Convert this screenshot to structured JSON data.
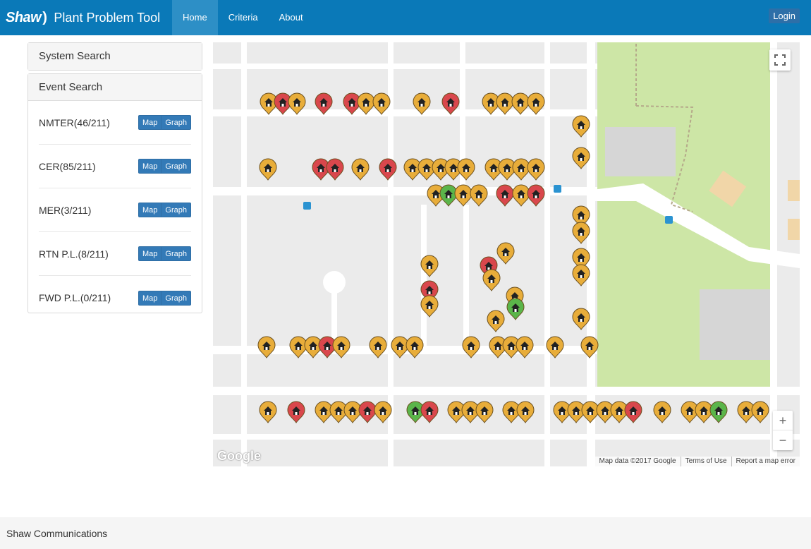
{
  "header": {
    "brand_logo": "Shaw",
    "brand_arc": ")",
    "app_title": "Plant Problem Tool",
    "nav": [
      {
        "label": "Home",
        "active": true
      },
      {
        "label": "Criteria",
        "active": false
      },
      {
        "label": "About",
        "active": false
      }
    ],
    "login_label": "Login"
  },
  "sidebar": {
    "system_search": "System Search",
    "event_search": "Event Search",
    "events": [
      {
        "label": "NMTER(46/211)",
        "map_label": "Map",
        "graph_label": "Graph"
      },
      {
        "label": "CER(85/211)",
        "map_label": "Map",
        "graph_label": "Graph"
      },
      {
        "label": "MER(3/211)",
        "map_label": "Map",
        "graph_label": "Graph"
      },
      {
        "label": "RTN P.L.(8/211)",
        "map_label": "Map",
        "graph_label": "Graph"
      },
      {
        "label": "FWD P.L.(0/211)",
        "map_label": "Map",
        "graph_label": "Graph"
      }
    ]
  },
  "map": {
    "google_logo": "Google",
    "attribution": [
      "Map data ©2017 Google",
      "Terms of Use",
      "Report a map error"
    ],
    "zoom_in": "+",
    "zoom_out": "−",
    "marker_colors": {
      "yellow": "#e8ad3a",
      "red": "#d9474c",
      "green": "#5bb54a"
    },
    "marker_icon": "house-icon"
  },
  "footer": {
    "text": "Shaw Communications"
  }
}
